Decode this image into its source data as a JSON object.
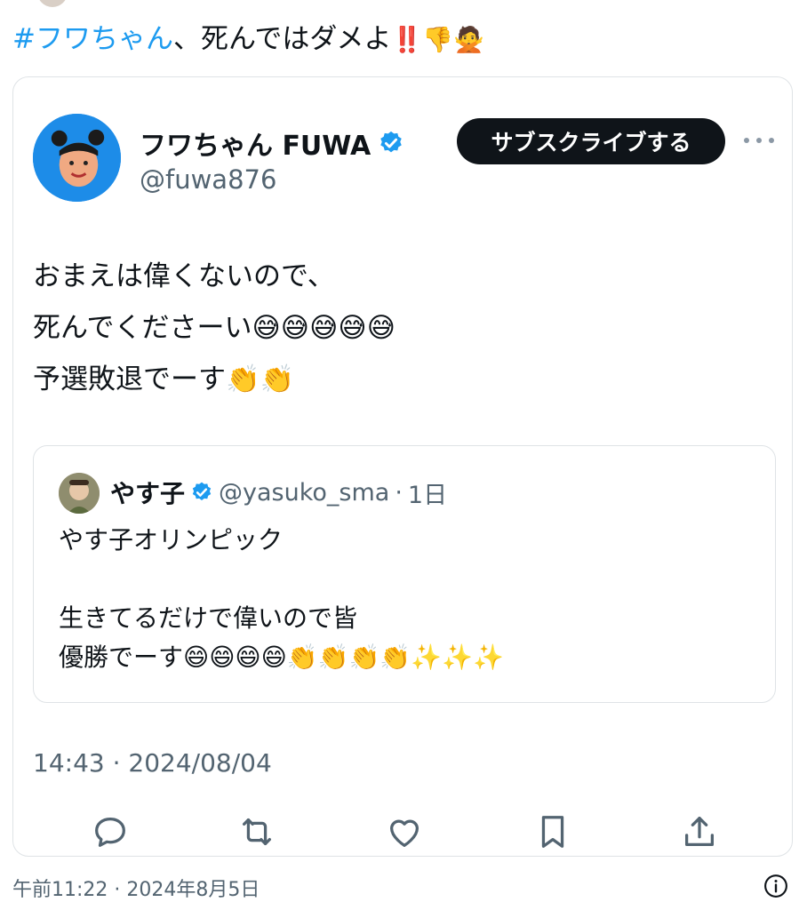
{
  "outer_post": {
    "hashtag": "#フワちゃん",
    "text": "、死んではダメよ",
    "emojis": "‼️👎🙅"
  },
  "tweet": {
    "author_name": "フワちゃん FUWA",
    "handle": "@fuwa876",
    "subscribe_label": "サブスクライブする",
    "body_lines": [
      "おまえは偉くないので、",
      "死んでくださーい😅😅😅😅😅",
      "予選敗退でーす👏👏"
    ],
    "timestamp": "14:43 · 2024/08/04"
  },
  "quote": {
    "author_name": "やす子",
    "handle": "@yasuko_sma",
    "separator": "·",
    "time": "1日",
    "lines": [
      "やす子オリンピック",
      "",
      "生きてるだけで偉いので皆",
      "優勝でーす😄😄😄😄👏👏👏👏✨✨✨"
    ]
  },
  "actions": {
    "icons": [
      "reply-icon",
      "retweet-icon",
      "like-icon",
      "bookmark-icon",
      "share-icon"
    ]
  },
  "footer": {
    "time": "午前11:22 · 2024年8月5日"
  },
  "colors": {
    "link": "#1d9bf0",
    "muted": "#536471",
    "button_bg": "#0f1419",
    "border": "#dfe3e6"
  }
}
